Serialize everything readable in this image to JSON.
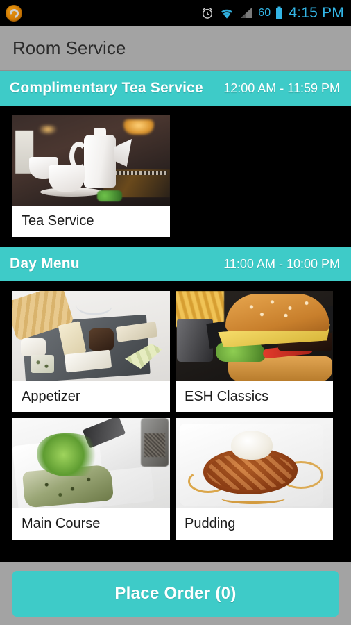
{
  "status_bar": {
    "app_icon": "app-logo-icon",
    "icons": [
      "alarm-clock-icon",
      "wifi-icon",
      "cellular-signal-icon",
      "battery-icon"
    ],
    "battery_level": "60",
    "time": "4:15 PM"
  },
  "title_bar": {
    "title": "Room Service"
  },
  "sections": [
    {
      "title": "Complimentary Tea Service",
      "hours": "12:00 AM - 11:59 PM",
      "items": [
        {
          "label": "Tea Service",
          "photo": "tea-service-photo"
        }
      ]
    },
    {
      "title": "Day Menu",
      "hours": "11:00 AM - 10:00 PM",
      "items": [
        {
          "label": "Appetizer",
          "photo": "appetizer-photo"
        },
        {
          "label": "ESH Classics",
          "photo": "esh-classics-photo"
        },
        {
          "label": "Main Course",
          "photo": "main-course-photo"
        },
        {
          "label": "Pudding",
          "photo": "pudding-photo"
        }
      ]
    }
  ],
  "bottom_bar": {
    "place_order_label": "Place Order (0)"
  },
  "colors": {
    "accent_teal": "#3ECBC8",
    "title_bar_gray": "#A3A3A3",
    "background_black": "#000000",
    "status_text_blue": "#33B5E5",
    "app_icon_orange": "#D37C05"
  }
}
